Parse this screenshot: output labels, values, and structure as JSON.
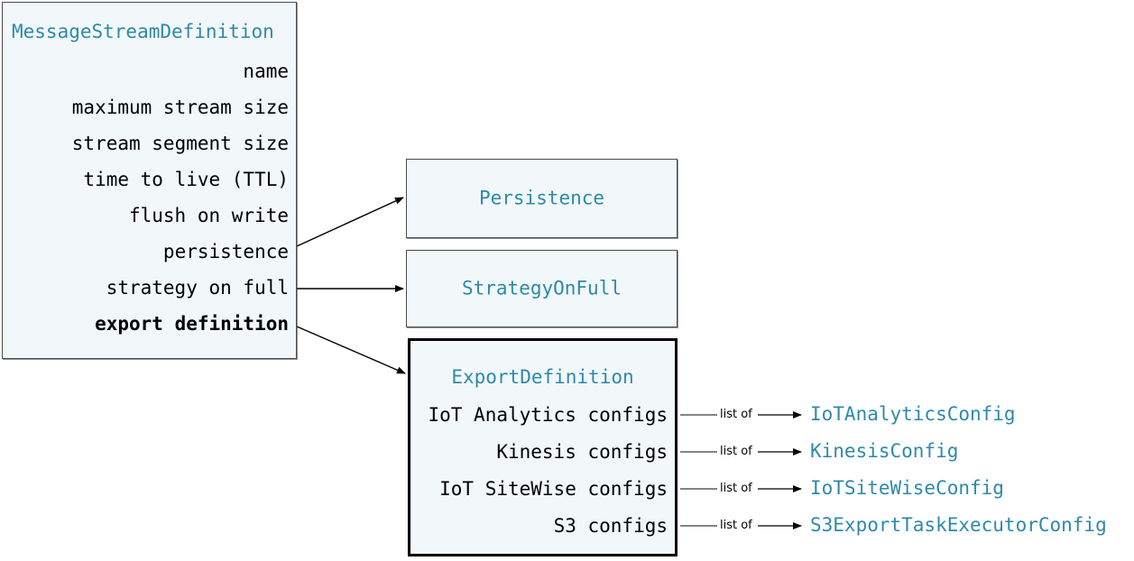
{
  "diagram": {
    "title": "MessageStreamDefinition",
    "accent_color": "#2e8aa8",
    "box_fill": "#f2f7fa",
    "box_border": "#4a4a4a",
    "highlight_border": "#000000"
  },
  "main_class": {
    "name": "MessageStreamDefinition",
    "fields": [
      {
        "label": "name",
        "bold": false
      },
      {
        "label": "maximum stream size",
        "bold": false
      },
      {
        "label": "stream segment size",
        "bold": false
      },
      {
        "label": "time to live (TTL)",
        "bold": false
      },
      {
        "label": "flush on write",
        "bold": false
      },
      {
        "label": "persistence",
        "bold": false
      },
      {
        "label": "strategy on full",
        "bold": false
      },
      {
        "label": "export definition",
        "bold": true
      }
    ]
  },
  "persistence_class": {
    "name": "Persistence"
  },
  "strategy_class": {
    "name": "StrategyOnFull"
  },
  "export_class": {
    "name": "ExportDefinition",
    "fields": [
      {
        "label": "IoT Analytics configs"
      },
      {
        "label": "Kinesis configs"
      },
      {
        "label": "IoT SiteWise configs"
      },
      {
        "label": "S3 configs"
      }
    ]
  },
  "leaf_classes": [
    {
      "name": "IoTAnalyticsConfig",
      "edge_caption": "list of"
    },
    {
      "name": "KinesisConfig",
      "edge_caption": "list of"
    },
    {
      "name": "IoTSiteWiseConfig",
      "edge_caption": "list of"
    },
    {
      "name": "S3ExportTaskExecutorConfig",
      "edge_caption": "list of"
    }
  ]
}
